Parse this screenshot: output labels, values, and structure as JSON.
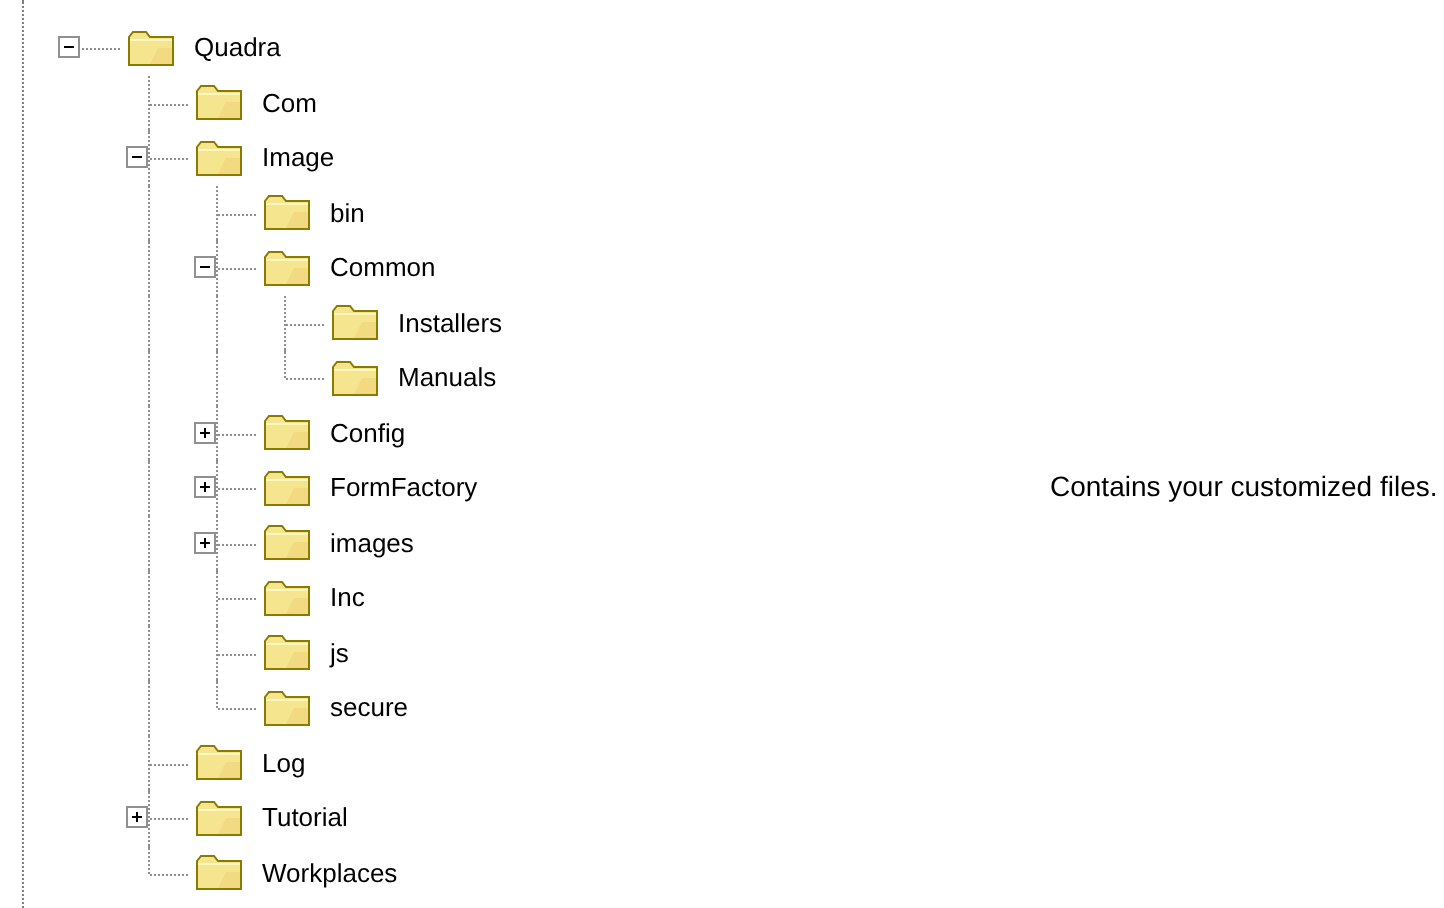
{
  "tree": {
    "items": [
      {
        "label": "Quadra",
        "expanded": true,
        "children": [
          {
            "label": "Com"
          },
          {
            "label": "Image",
            "expanded": true,
            "children": [
              {
                "label": "bin"
              },
              {
                "label": "Common",
                "expanded": true,
                "children": [
                  {
                    "label": "Installers"
                  },
                  {
                    "label": "Manuals"
                  }
                ]
              },
              {
                "label": "Config",
                "expanded": false
              },
              {
                "label": "FormFactory",
                "expanded": false
              },
              {
                "label": "images",
                "expanded": false
              },
              {
                "label": "Inc"
              },
              {
                "label": "js"
              },
              {
                "label": "secure"
              }
            ]
          },
          {
            "label": "Log"
          },
          {
            "label": "Tutorial",
            "expanded": false
          },
          {
            "label": "Workplaces"
          }
        ]
      }
    ]
  },
  "description": "Contains your customized files."
}
